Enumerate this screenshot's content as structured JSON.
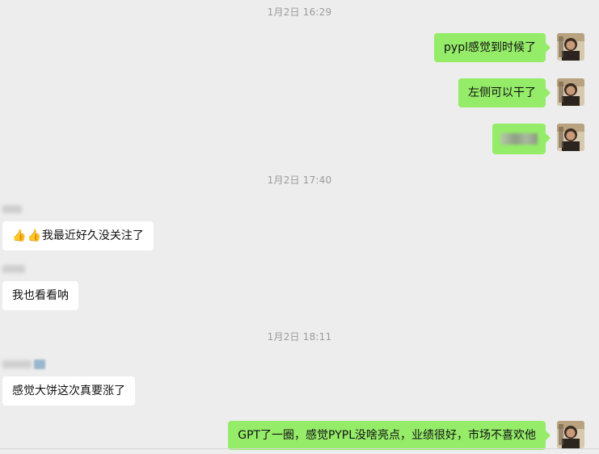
{
  "timestamps": {
    "t1": "1月2日 16:29",
    "t2": "1月2日 17:40",
    "t3": "1月2日 18:11"
  },
  "messages_self": {
    "m1": "pypl感觉到时候了",
    "m2": "左侧可以干了",
    "m4": "GPT了一圈，感觉PYPL没啥亮点，业绩很好，市场不喜欢他"
  },
  "messages_other": {
    "m1_emoji": [
      "👍",
      "👍"
    ],
    "m1_text": "我最近好久没关注了",
    "m2": "我也看看呐",
    "m3": "感觉大饼这次真要涨了"
  },
  "colors": {
    "background": "#ededed",
    "self_bubble": "#95ec69",
    "other_bubble": "#ffffff",
    "timestamp": "#9b9b9b"
  }
}
